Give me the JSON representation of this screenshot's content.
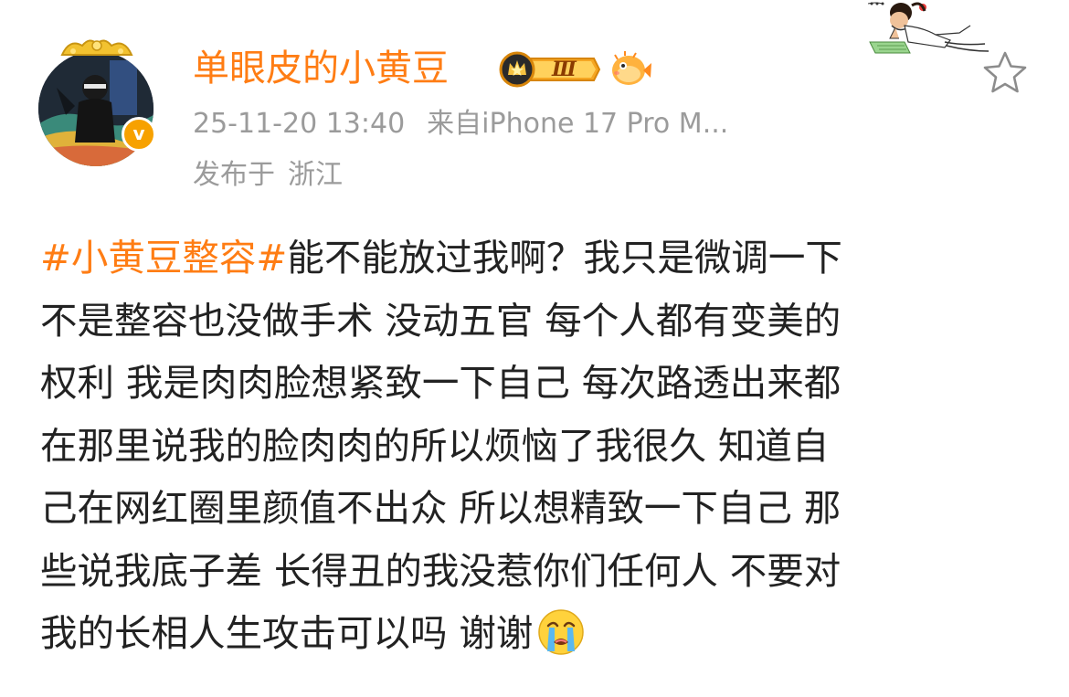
{
  "user": {
    "name": "单眼皮的小黄豆",
    "vip_level": "Ⅲ",
    "verified_mark": "v"
  },
  "post": {
    "timestamp": "25-11-20 13:40",
    "source_prefix": "来自",
    "source": "iPhone 17 Pro M...",
    "location_prefix": "发布于",
    "location": "浙江",
    "hashtag": "#小黄豆整容#",
    "lines": [
      "能不能放过我啊？我只是微调一下",
      "不是整容也没做手术 没动五官 每个人都有变美的",
      "权利 我是肉肉脸想紧致一下自己 每次路透出来都",
      "在那里说我的脸肉肉的所以烦恼了我很久 知道自",
      "己在网红圈里颜值不出众 所以想精致一下自己 那",
      "些说我底子差 长得丑的我没惹你们任何人 不要对",
      "我的长相人生攻击可以吗 谢谢"
    ],
    "emoji": "crying-face-icon"
  },
  "colors": {
    "accent": "#ff7d14",
    "meta_text": "#9b9b9b",
    "body_text": "#222222",
    "verified": "#f7a100"
  }
}
